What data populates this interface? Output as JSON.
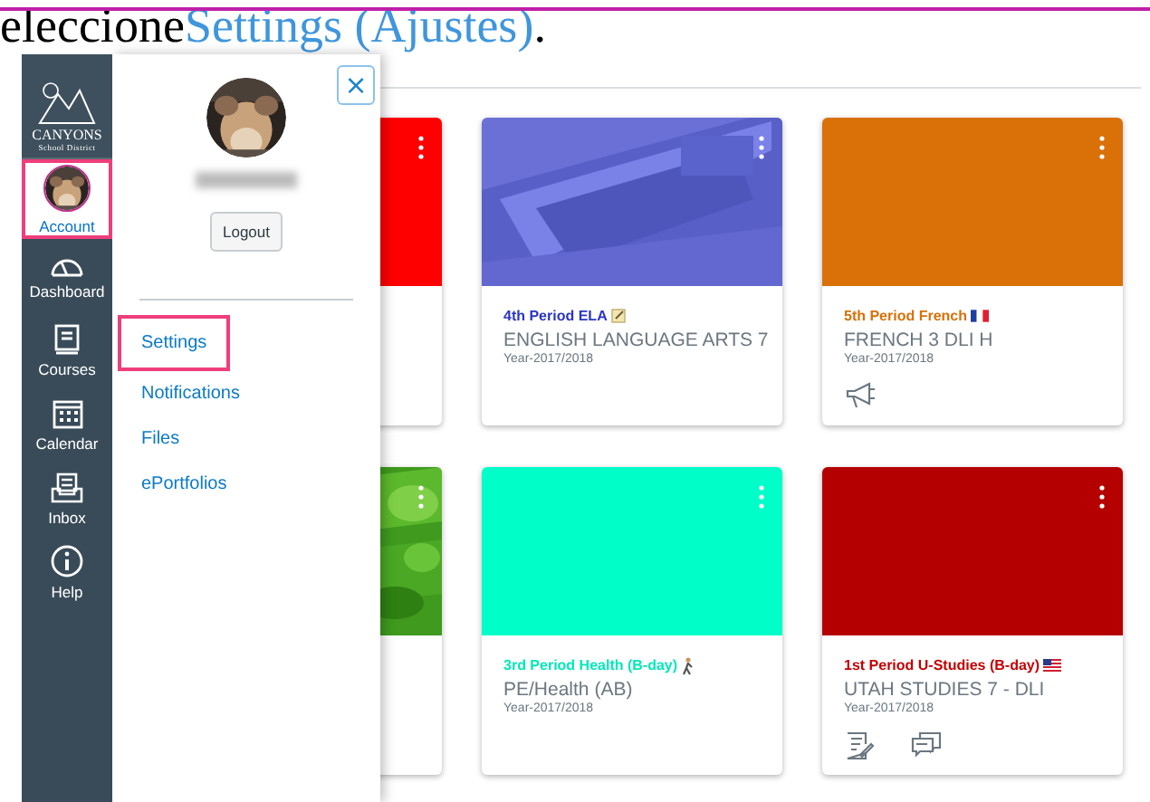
{
  "heading": {
    "parts": [
      {
        "kind": "plain",
        "text": "eleccione"
      },
      {
        "kind": "link",
        "text": "Settings (Ajustes)"
      },
      {
        "kind": "plain",
        "text": "."
      }
    ]
  },
  "global_nav": {
    "logo": {
      "name": "CANYONS",
      "subtitle": "School District"
    },
    "items": [
      {
        "kind": "account",
        "label": "Account",
        "selected": true
      },
      {
        "kind": "dashboard",
        "label": "Dashboard",
        "selected": false
      },
      {
        "kind": "courses",
        "label": "Courses",
        "selected": false
      },
      {
        "kind": "calendar",
        "label": "Calendar",
        "selected": false
      },
      {
        "kind": "inbox",
        "label": "Inbox",
        "selected": false
      },
      {
        "kind": "help",
        "label": "Help",
        "selected": false
      }
    ]
  },
  "account_tray": {
    "close": "×",
    "name_blurred": true,
    "logout": "Logout",
    "links": [
      {
        "label": "Settings",
        "highlighted": true
      },
      {
        "label": "Notifications",
        "highlighted": false
      },
      {
        "label": "Files",
        "highlighted": false
      },
      {
        "label": "ePortfolios",
        "highlighted": false
      }
    ]
  },
  "cards": [
    {
      "header": {
        "kind": "color",
        "color": "#ff0000"
      }
    },
    {
      "nickname": "4th Period ELA",
      "badge": {
        "kind": "memo"
      },
      "color": "#2b35c2",
      "course": "ENGLISH LANGUAGE ARTS 7",
      "term": "Year-2017/2018"
    },
    {
      "header": {
        "kind": "color",
        "color": "#d97008"
      },
      "nickname": "5th Period French",
      "badge": {
        "kind": "flag-fr"
      },
      "color": "#d97008",
      "course": "FRENCH 3 DLI H",
      "term": "Year-2017/2018",
      "icons": [
        {
          "kind": "announcement"
        }
      ]
    },
    {
      "header": {
        "kind": "grass"
      }
    },
    {
      "header": {
        "kind": "color",
        "color": "#00ffc8"
      },
      "nickname": "3rd Period Health (B-day)",
      "badge": {
        "kind": "walker"
      },
      "color": "#00e8b8",
      "course": "PE/Health (AB)",
      "term": "Year-2017/2018"
    },
    {
      "header": {
        "kind": "color",
        "color": "#b50000"
      },
      "nickname": "1st Period U-Studies (B-day)",
      "badge": {
        "kind": "flag-us"
      },
      "color": "#c40000",
      "course": "UTAH STUDIES 7 - DLI",
      "term": "Year-2017/2018",
      "icons": [
        {
          "kind": "assignment"
        },
        {
          "kind": "discussion"
        }
      ]
    }
  ]
}
